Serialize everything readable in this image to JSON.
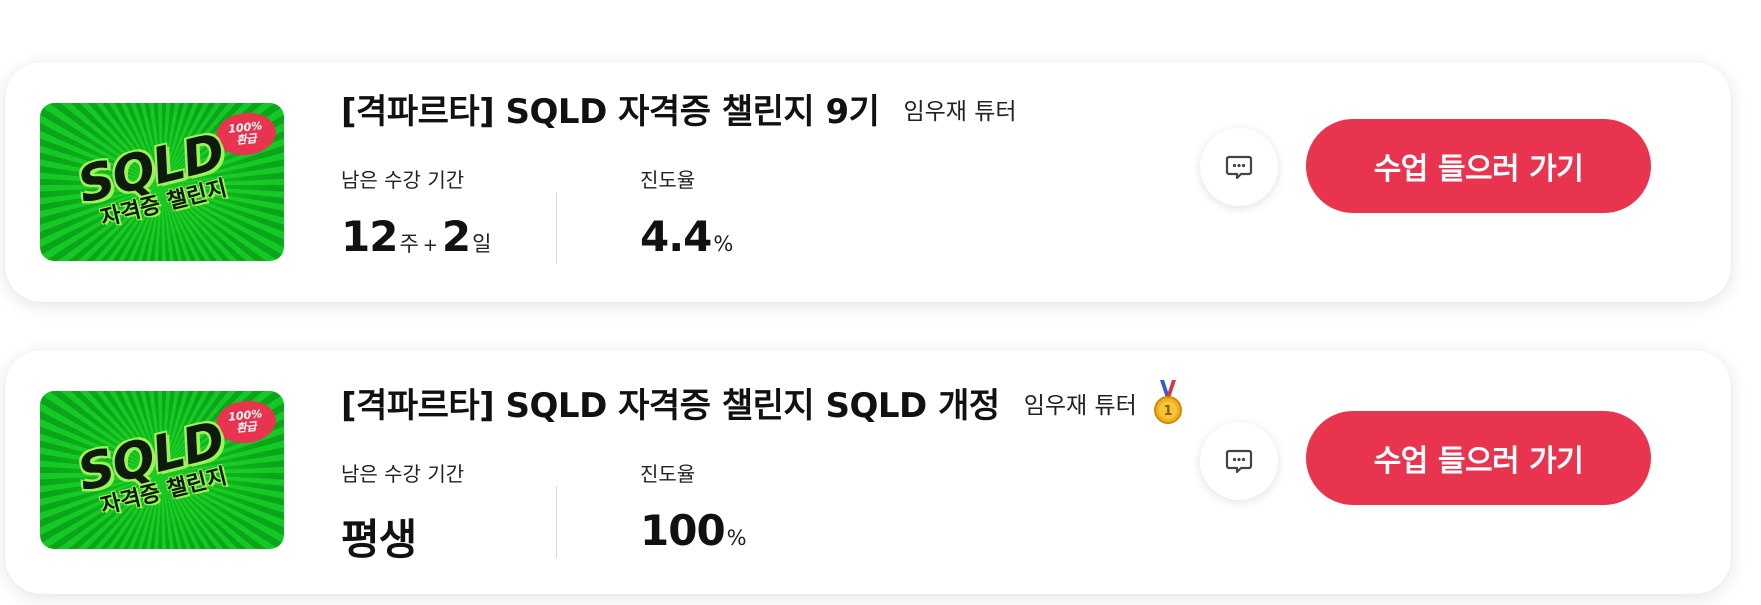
{
  "courses": [
    {
      "title": "[격파르타] SQLD 자격증 챌린지 9기",
      "tutor": "임우재 튜터",
      "has_medal": false,
      "thumbnail": {
        "logo_text": "SQLD",
        "sub_text": "자격증 챌린지",
        "badge_line1": "100%",
        "badge_line2": "환급"
      },
      "period_label": "남은 수강 기간",
      "period_weeks": "12",
      "period_week_unit": "주",
      "period_plus": "+",
      "period_days": "2",
      "period_day_unit": "일",
      "progress_label": "진도율",
      "progress_value": "4.4",
      "progress_unit": "%",
      "cta_label": "수업 들으러 가기"
    },
    {
      "title": "[격파르타] SQLD 자격증 챌린지 SQLD 개정",
      "tutor": "임우재 튜터",
      "has_medal": true,
      "thumbnail": {
        "logo_text": "SQLD",
        "sub_text": "자격증 챌린지",
        "badge_line1": "100%",
        "badge_line2": "환급"
      },
      "period_label": "남은 수강 기간",
      "period_value": "평생",
      "progress_label": "진도율",
      "progress_value": "100",
      "progress_unit": "%",
      "cta_label": "수업 들으러 가기"
    }
  ],
  "colors": {
    "accent": "#e8344e",
    "thumb_green": "#14c924",
    "medal_gold": "#f2b01e"
  },
  "icons": {
    "chat": "chat-bubble-icon",
    "medal": "gold-medal-icon"
  }
}
